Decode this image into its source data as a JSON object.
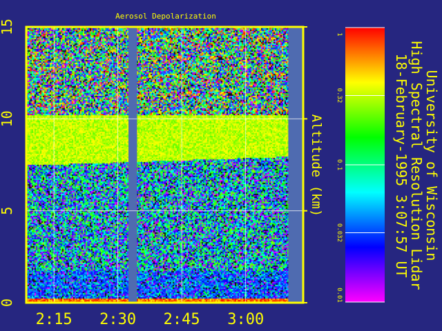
{
  "colors": {
    "background": "#262680",
    "frame": "#ffff00",
    "text": "#ffff00",
    "gap": "#4f6bb0"
  },
  "chart_data": {
    "type": "heatmap",
    "title": "Aerosol Depolarization",
    "header_lines": [
      "University of Wisconsin",
      "High Spectral Resolution Lidar",
      "18-February-1995   3:07:57 UT"
    ],
    "ylabel": "Altitude (km)",
    "xlabel": "",
    "x_ticks": [
      "2:15",
      "2:30",
      "2:45",
      "3:00"
    ],
    "x_tick_minutes": [
      135,
      150,
      165,
      180
    ],
    "xlim_minutes": [
      128.5,
      193.5
    ],
    "y_ticks": [
      0,
      5,
      10,
      15
    ],
    "ylim": [
      0,
      15
    ],
    "grid": true,
    "data_gaps_minutes": [
      [
        152.5,
        154.5
      ],
      [
        190.0,
        193.5
      ]
    ],
    "features": [
      {
        "name": "aerosol layer",
        "altitude_km_bottom_start": 7.5,
        "altitude_km_bottom_end": 8.0,
        "altitude_km_top": 10.2,
        "value": 0.32
      },
      {
        "name": "noise upper troposphere",
        "altitude_km_range": [
          10.2,
          15
        ],
        "value_range": [
          0.01,
          1
        ]
      },
      {
        "name": "noise lower troposphere",
        "altitude_km_range": [
          0.3,
          7.5
        ],
        "value_range": [
          0.01,
          0.1
        ]
      },
      {
        "name": "surface",
        "altitude_km_range": [
          0,
          0.3
        ],
        "value": 1
      }
    ],
    "colorbar": {
      "scale": "log",
      "range": [
        0.01,
        1
      ],
      "tick_labels": [
        "1",
        "0.32",
        "0.1",
        "0.032",
        "0.01"
      ],
      "tick_values": [
        1,
        0.32,
        0.1,
        0.032,
        0.01
      ],
      "colormap": [
        "#ff00ff",
        "#8000ff",
        "#0000ff",
        "#0080ff",
        "#00ffff",
        "#00ff80",
        "#00ff00",
        "#80ff00",
        "#ffff00",
        "#ff8000",
        "#ff0000"
      ]
    }
  }
}
